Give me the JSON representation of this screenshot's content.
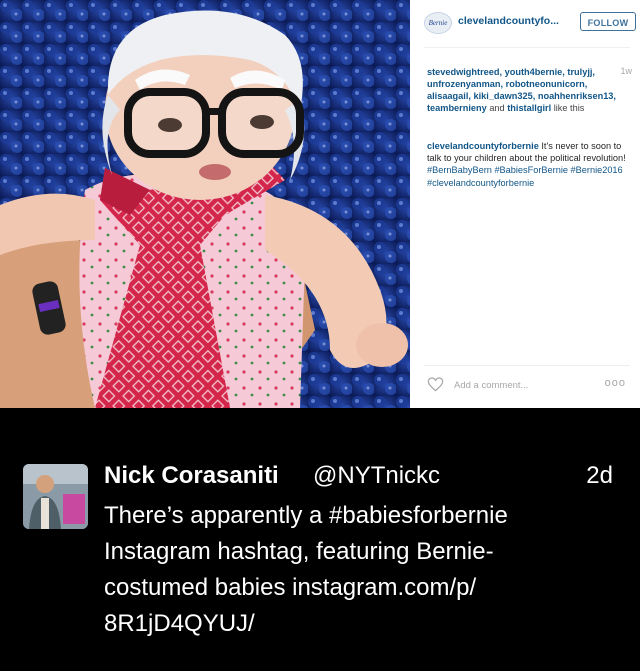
{
  "instagram": {
    "username": "clevelandcountyfo...",
    "avatar_text": "Bernie",
    "follow_label": "FOLLOW",
    "liked_by": [
      "stevedwightreed",
      "youth4bernie",
      "trulyjj",
      "unfrozenyanman",
      "robotneonunicorn",
      "alisaagail",
      "kiki_dawn325",
      "noahhenriksen13",
      "teambernieny",
      "thistallgirl"
    ],
    "likes_suffix": "like this",
    "age": "1w",
    "caption_user": "clevelandcountyforbernie",
    "caption_text": "It's never to soon to talk to your children about the political revolution!",
    "hashtags": [
      "#BernBabyBern",
      "#BabiesForBernie",
      "#Bernie2016",
      "#clevelandcountyforbernie"
    ],
    "comment_placeholder": "Add a comment...",
    "more_label": "ooo"
  },
  "tweet": {
    "name": "Nick Corasaniti",
    "handle": "@NYTnickc",
    "time": "2d",
    "lines": [
      "There’s apparently a #babiesforbernie",
      "Instagram hashtag, featuring Bernie-",
      "costumed babies instagram.com/p/",
      "8R1jD4QYUJ/"
    ]
  },
  "colors": {
    "background": "#000000",
    "ig_link": "#125688",
    "follow_blue": "#3f729b",
    "muted": "#a5a7aa"
  },
  "icons": [
    "heart-icon",
    "more-options-icon",
    "avatar-image"
  ]
}
